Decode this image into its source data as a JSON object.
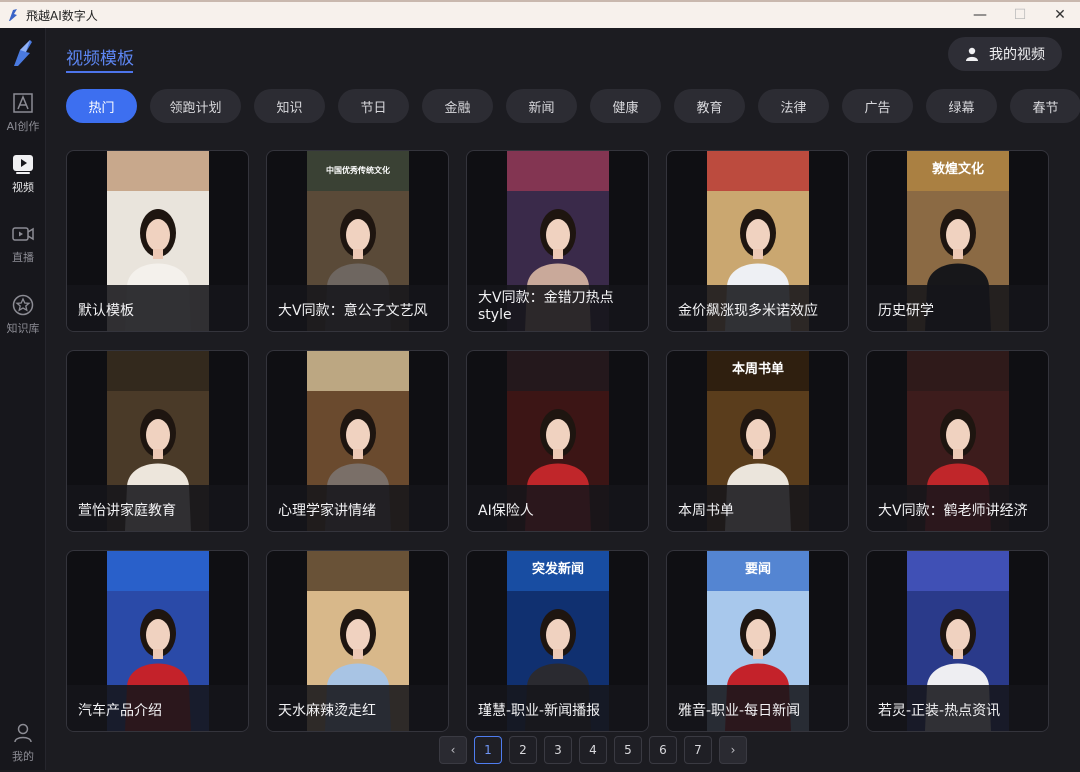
{
  "window": {
    "title": "飛越AI数字人",
    "minimize": "—",
    "maximize": "☐",
    "close": "✕"
  },
  "sidebar": {
    "items": [
      {
        "label": "AI创作",
        "icon": "ai-text-icon"
      },
      {
        "label": "视频",
        "icon": "video-play-icon",
        "active": true
      },
      {
        "label": "直播",
        "icon": "live-camera-icon"
      },
      {
        "label": "知识库",
        "icon": "star-circle-icon"
      }
    ],
    "user_label": "我的"
  },
  "header": {
    "page_title": "视频模板",
    "my_video_label": "我的视频"
  },
  "categories": [
    "热门",
    "领跑计划",
    "知识",
    "节日",
    "金融",
    "新闻",
    "健康",
    "教育",
    "法律",
    "广告",
    "绿幕",
    "春节"
  ],
  "active_category": "热门",
  "templates": [
    {
      "title": "默认模板",
      "bg": "#e9e4dc",
      "suit": "#f4f1ec",
      "top": "#b98f6a"
    },
    {
      "title": "大V同款：意公子文艺风",
      "bg": "#5a4a38",
      "suit": "#6e6660",
      "top": "#2c3d33",
      "banner": "中国优秀传统文化"
    },
    {
      "title": "大V同款：金错刀热点style",
      "bg": "#3a2a4a",
      "suit": "#c9a99a",
      "top": "#a33a56"
    },
    {
      "title": "金价飙涨现多米诺效应",
      "bg": "#caa770",
      "suit": "#eef0f4",
      "top": "#b6242a"
    },
    {
      "title": "历史研学",
      "bg": "#8b6a44",
      "suit": "#17171a",
      "top": "#b88a42",
      "banner": "敦煌文化"
    },
    {
      "title": "萱怡讲家庭教育",
      "bg": "#4a3a28",
      "suit": "#ede6dc",
      "top": "#2a2218"
    },
    {
      "title": "心理学家讲情绪",
      "bg": "#6a4a2e",
      "suit": "#7a6f68",
      "top": "#e0cfa6"
    },
    {
      "title": "AI保险人",
      "bg": "#3c1515",
      "suit": "#c0262a",
      "top": "#1a1a1f"
    },
    {
      "title": "本周书单",
      "bg": "#5a3d1c",
      "suit": "#ebe5dc",
      "top": "#1c130a",
      "banner": "本周书单"
    },
    {
      "title": "大V同款：鹤老师讲经济",
      "bg": "#3d1c1c",
      "suit": "#c0262a",
      "top": "#2a1a1a"
    },
    {
      "title": "汽车产品介绍",
      "bg": "#2a4aa8",
      "suit": "#c4222a",
      "top": "#2a6ad8"
    },
    {
      "title": "天水麻辣烫走红",
      "bg": "#d8b88a",
      "suit": "#a8c4e4",
      "top": "#3a2614"
    },
    {
      "title": "瑾慧-职业-新闻播报",
      "bg": "#103070",
      "suit": "#2a2a30",
      "top": "#1c5ab8",
      "banner": "突发新闻"
    },
    {
      "title": "雅音-职业-每日新闻",
      "bg": "#a8c8ec",
      "suit": "#c4222a",
      "top": "#3068c8",
      "banner": "要闻"
    },
    {
      "title": "若灵-正装-热点资讯",
      "bg": "#2a3a8a",
      "suit": "#eeeef2",
      "top": "#4a5ac8"
    }
  ],
  "pagination": {
    "prev": "‹",
    "next": "›",
    "pages": [
      "1",
      "2",
      "3",
      "4",
      "5",
      "6",
      "7"
    ],
    "current": "1"
  }
}
